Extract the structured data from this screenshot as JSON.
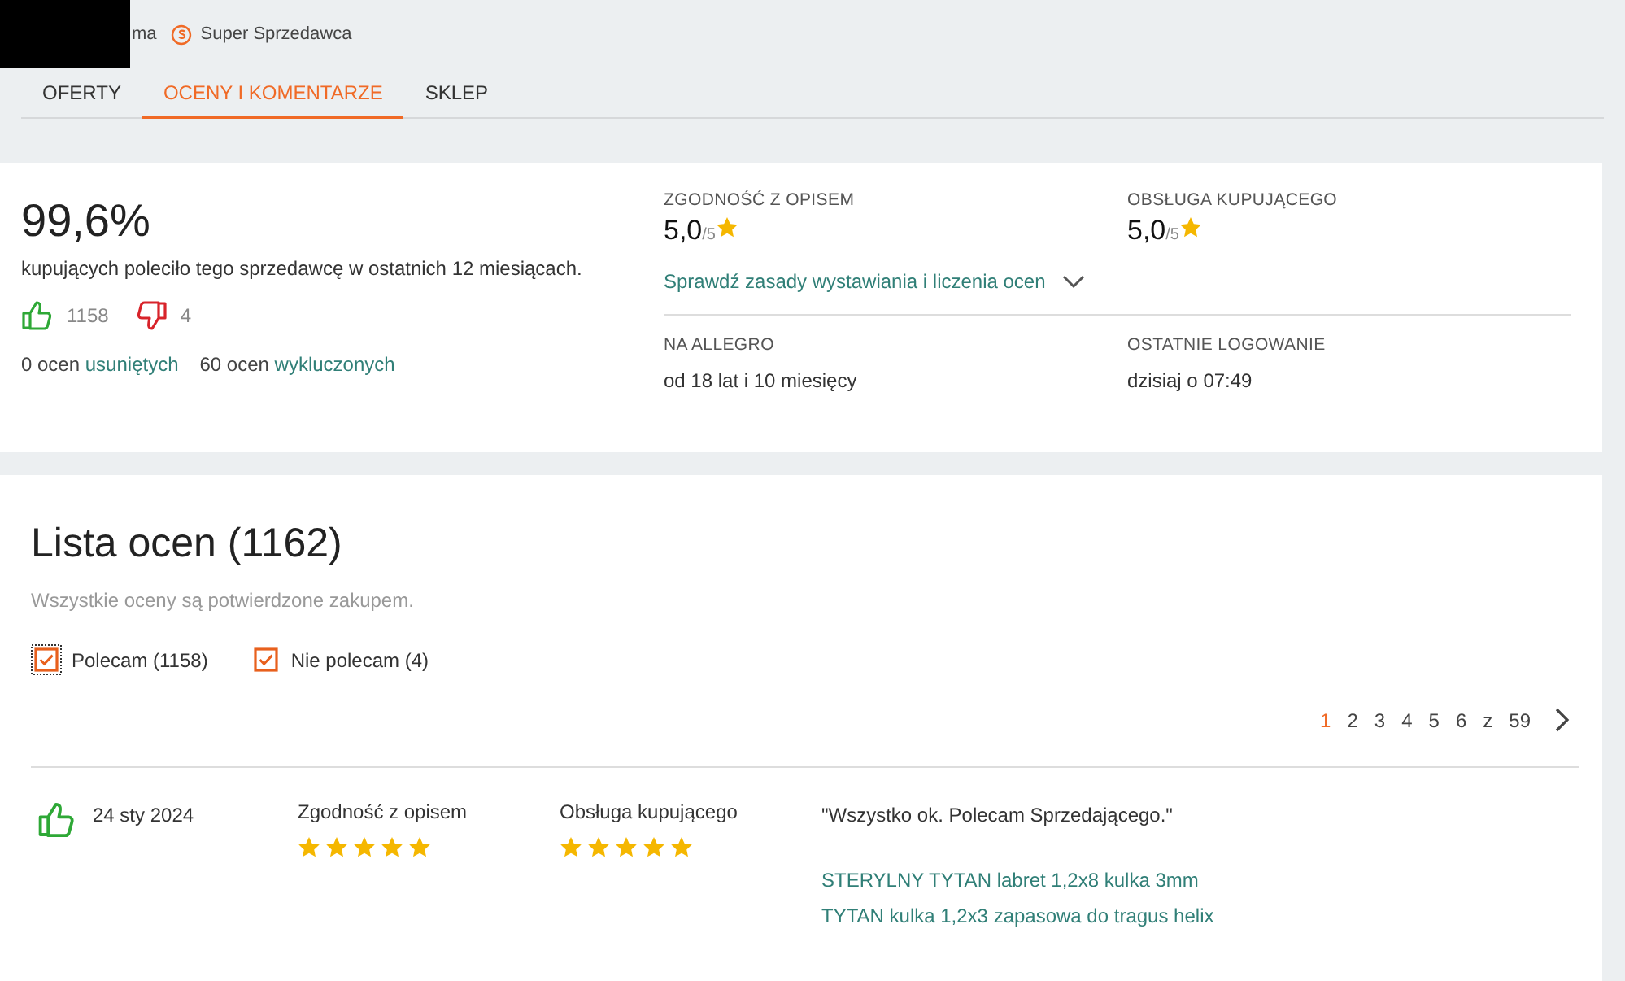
{
  "header": {
    "seller_name": "ma",
    "badge": "Super Sprzedawca"
  },
  "tabs": [
    {
      "label": "OFERTY",
      "selected": false
    },
    {
      "label": "OCENY I KOMENTARZE",
      "selected": true
    },
    {
      "label": "SKLEP",
      "selected": false
    }
  ],
  "summary": {
    "percent": "99,6%",
    "caption": "kupujących poleciło tego sprzedawcę w ostatnich 12 miesiącach.",
    "positive": "1158",
    "negative": "4",
    "removed_count": "0 ocen",
    "removed_link": "usuniętych",
    "excluded_count": "60 ocen",
    "excluded_link": "wykluczonych"
  },
  "ratings": [
    {
      "label": "ZGODNOŚĆ Z OPISEM",
      "score": "5,0",
      "scale": "/5"
    },
    {
      "label": "OBSŁUGA KUPUJĄCEGO",
      "score": "5,0",
      "scale": "/5"
    }
  ],
  "rules_link": {
    "label": "Sprawdź zasady wystawiania i liczenia ocen",
    "expanded": false
  },
  "info": [
    {
      "label": "NA ALLEGRO",
      "value": "od 18 lat i 10 miesięcy"
    },
    {
      "label": "OSTATNIE LOGOWANIE",
      "value": "dzisiaj o 07:49"
    }
  ],
  "list": {
    "title": "Lista ocen (1162)",
    "note": "Wszystkie oceny są potwierdzone zakupem.",
    "filters": [
      {
        "label": "Polecam (1158)",
        "checked": true,
        "focused": true
      },
      {
        "label": "Nie polecam (4)",
        "checked": true,
        "focused": false
      }
    ],
    "pagination": {
      "pages": [
        {
          "label": "1",
          "selected": true
        },
        {
          "label": "2",
          "selected": false
        },
        {
          "label": "3",
          "selected": false
        },
        {
          "label": "4",
          "selected": false
        },
        {
          "label": "5",
          "selected": false
        },
        {
          "label": "6",
          "selected": false
        }
      ],
      "separator": "z",
      "total": "59"
    },
    "reviews": [
      {
        "kind": "positive",
        "date": "24 sty 2024",
        "criteria": [
          {
            "label": "Zgodność z opisem",
            "stars": 5
          },
          {
            "label": "Obsługa kupującego",
            "stars": 5
          }
        ],
        "comment": "\"Wszystko ok. Polecam Sprzedającego.\"",
        "products": [
          "STERYLNY TYTAN labret 1,2x8 kulka 3mm",
          "TYTAN kulka 1,2x3 zapasowa do tragus helix"
        ]
      }
    ]
  }
}
